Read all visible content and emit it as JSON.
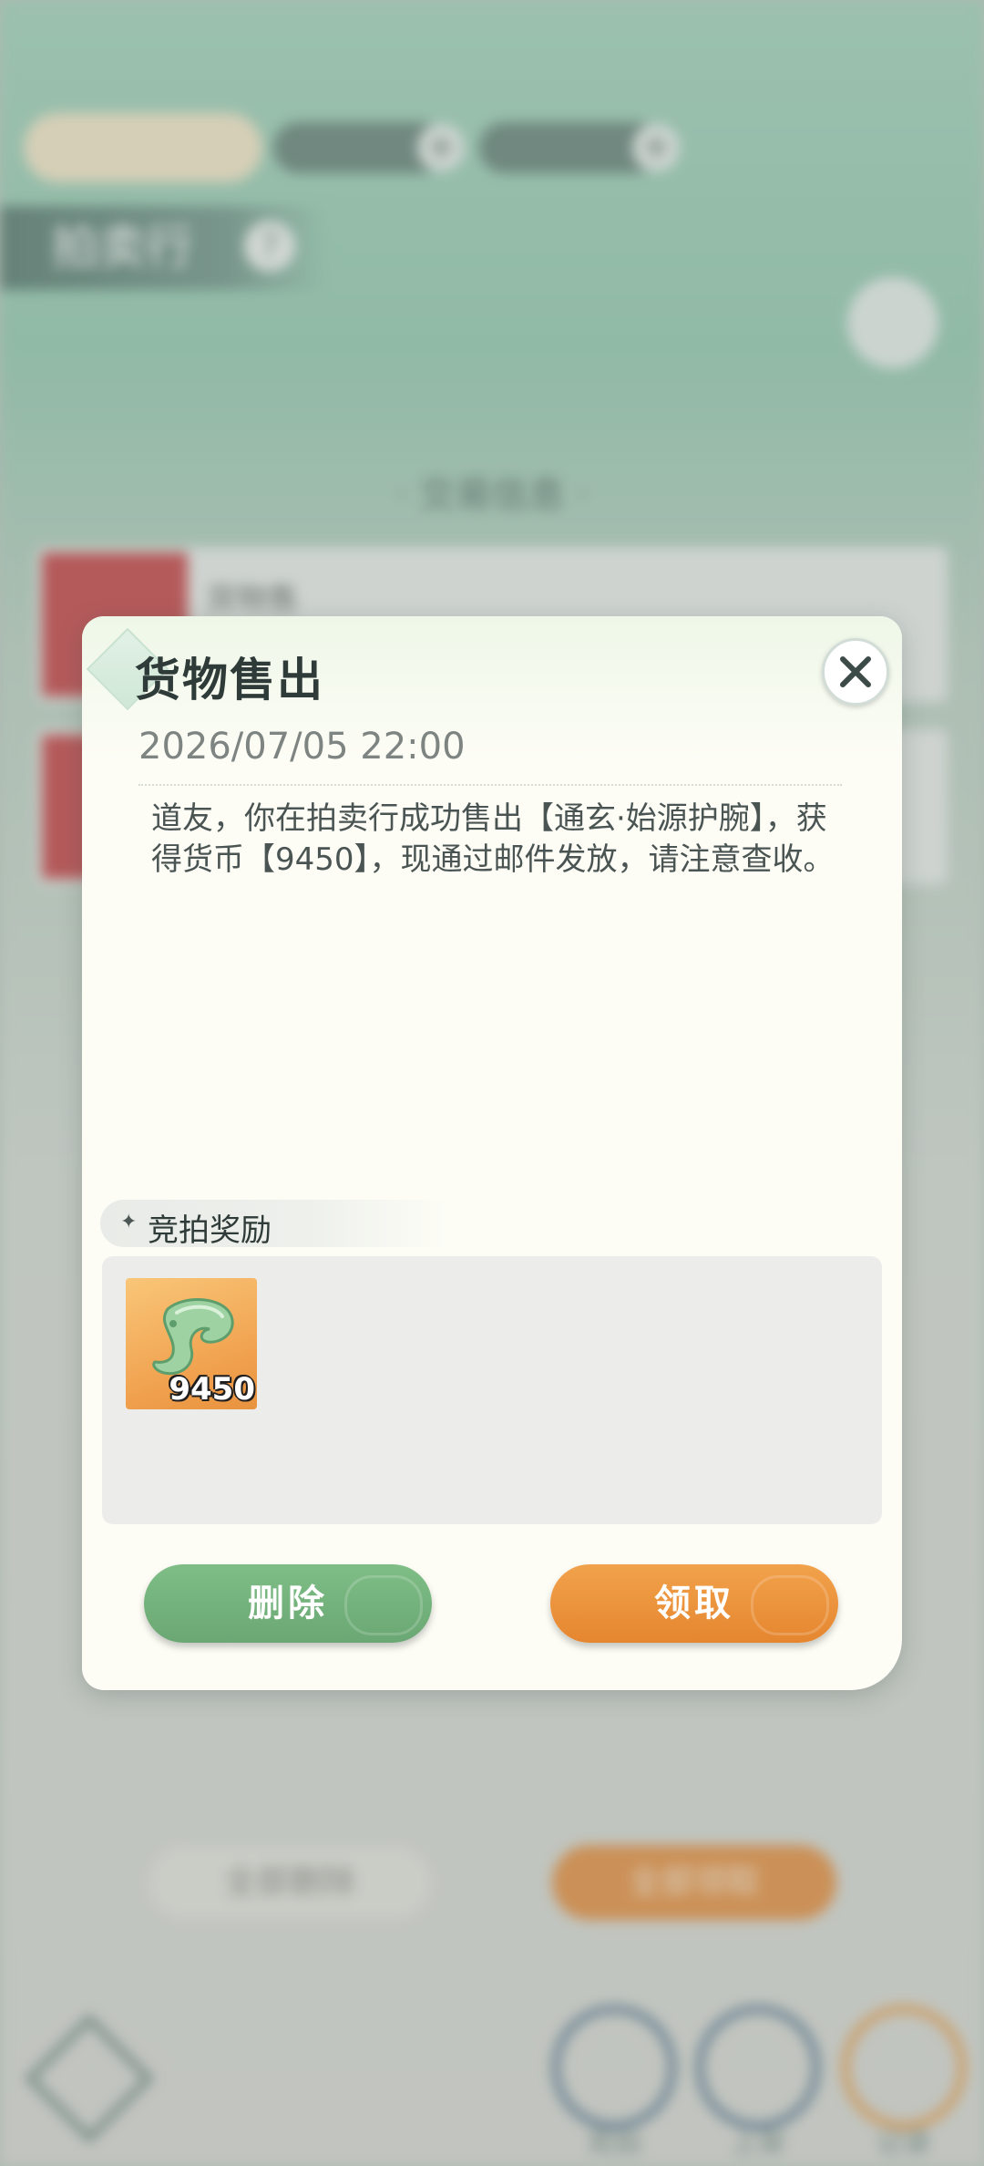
{
  "background": {
    "title": "拍卖行",
    "help_icon": "?",
    "section_title": "· 交易信息 ·",
    "row1_text": "货物售",
    "btn_delete_all": "全部删除",
    "btn_claim_all": "全部领取",
    "nav": [
      {
        "label": "竞拍",
        "icon": "auction-icon"
      },
      {
        "label": "上架",
        "icon": "listing-icon"
      },
      {
        "label": "记录",
        "icon": "record-icon"
      }
    ]
  },
  "dialog": {
    "title": "货物售出",
    "time": "2026/07/05 22:00",
    "message": "道友，你在拍卖行成功售出【通玄·始源护腕】，获得货币【9450】，现通过邮件发放，请注意查收。",
    "reward_header": "竞拍奖励",
    "reward_item": {
      "icon": "jade-currency-icon",
      "quantity": "9450"
    },
    "delete_label": "删除",
    "claim_label": "领取"
  },
  "colors": {
    "green_button": "#6aa774",
    "orange_button": "#e5862f",
    "dialog_bg": "#fdfdf6"
  }
}
